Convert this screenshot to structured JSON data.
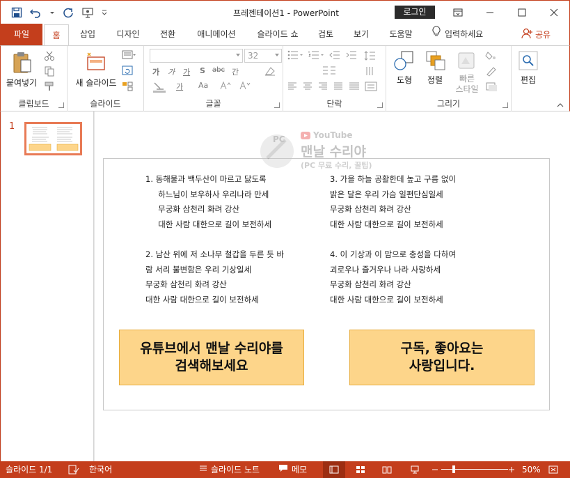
{
  "window": {
    "title": "프레젠테이션1  -  PowerPoint",
    "login_label": "로그인"
  },
  "tabs": {
    "file": "파일",
    "items": [
      "홈",
      "삽입",
      "디자인",
      "전환",
      "애니메이션",
      "슬라이드 쇼",
      "검토",
      "보기",
      "도움말"
    ],
    "active_index": 0,
    "tell_me": "입력하세요",
    "share": "공유"
  },
  "ribbon": {
    "clipboard": {
      "paste": "붙여넣기",
      "label": "클립보드"
    },
    "slides": {
      "new_slide": "새 슬라이드",
      "label": "슬라이드"
    },
    "font": {
      "size": "32",
      "label": "글꼴",
      "bold": "가",
      "italic": "가",
      "underline": "가",
      "shadow": "S",
      "strike": "abc",
      "spacing": "간",
      "color": "가",
      "case": "Aa"
    },
    "paragraph": {
      "label": "단락"
    },
    "drawing": {
      "shape": "도형",
      "arrange": "정렬",
      "quick_styles_1": "빠른",
      "quick_styles_2": "스타일",
      "label": "그리기"
    },
    "editing": {
      "edit": "편집"
    }
  },
  "thumbnail": {
    "number": "1"
  },
  "slide": {
    "stanza1": [
      "1.  동해물과 백두산이 마르고 닳도록",
      "     하느님이 보우하사 우리나라 만세",
      "     무궁화 삼천리 화려 강산",
      "     대한 사람 대한으로 길이 보전하세"
    ],
    "stanza2": [
      "2. 남산 위에 저 소나무 철갑을 두른 듯 바",
      "람 서리 불변함은 우리 기상일세",
      "무궁화 삼천리 화려 강산",
      "대한 사람 대한으로 길이 보전하세"
    ],
    "stanza3": [
      "3. 가을 하늘 공활한데 높고 구름 없이",
      "밝은 달은 우리 가슴 일편단심일세",
      "무궁화 삼천리 화려 강산",
      "대한 사람 대한으로 길이 보전하세"
    ],
    "stanza4": [
      "4. 이 기상과 이 맘으로 충성을 다하여",
      "괴로우나 즐거우나 나라 사랑하세",
      "무궁화 삼천리 화려 강산",
      "대한 사람 대한으로 길이 보전하세"
    ],
    "callout_left": [
      "유튜브에서 맨날 수리야를",
      "검색해보세요"
    ],
    "callout_right": [
      "구독, 좋아요는",
      "사랑입니다."
    ]
  },
  "watermark": {
    "badge": "PC",
    "site": "YouTube",
    "name": "맨날 수리야",
    "sub": "(PC 무료 수리, 꿀팁)"
  },
  "status": {
    "slide_count": "슬라이드 1/1",
    "language": "한국어",
    "notes": "슬라이드 노트",
    "comments": "메모",
    "zoom": "50%"
  },
  "colors": {
    "accent": "#c43e1c",
    "callout_fill": "#fdd58a",
    "callout_border": "#e8ad3c"
  }
}
